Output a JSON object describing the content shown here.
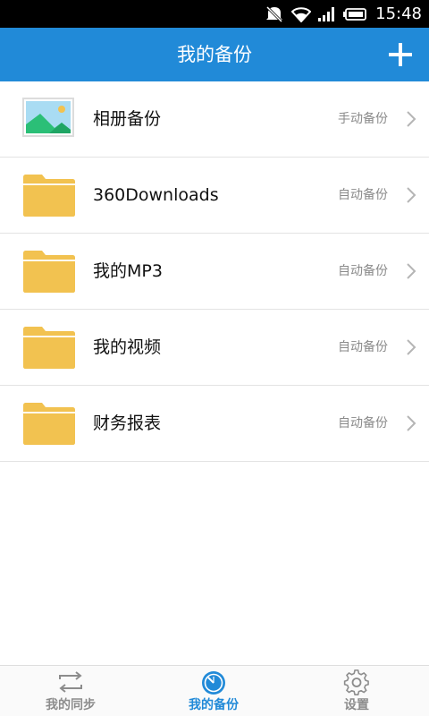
{
  "status_bar": {
    "time": "15:48",
    "icons": [
      "mute-icon",
      "wifi-icon",
      "signal-icon",
      "battery-icon"
    ]
  },
  "app_bar": {
    "title": "我的备份",
    "add_icon": "plus-icon"
  },
  "backup_list": [
    {
      "label": "相册备份",
      "mode": "手动备份",
      "icon": "photo-album-icon"
    },
    {
      "label": "360Downloads",
      "mode": "自动备份",
      "icon": "folder-icon"
    },
    {
      "label": "我的MP3",
      "mode": "自动备份",
      "icon": "folder-icon"
    },
    {
      "label": "我的视频",
      "mode": "自动备份",
      "icon": "folder-icon"
    },
    {
      "label": "财务报表",
      "mode": "自动备份",
      "icon": "folder-icon"
    }
  ],
  "bottom_nav": [
    {
      "label": "我的同步",
      "icon": "sync-arrows-icon",
      "active": false
    },
    {
      "label": "我的备份",
      "icon": "backup-clock-icon",
      "active": true
    },
    {
      "label": "设置",
      "icon": "gear-icon",
      "active": false
    }
  ],
  "colors": {
    "accent": "#218ad8",
    "folder": "#f2c250",
    "secondary_text": "#8a8a8a"
  }
}
